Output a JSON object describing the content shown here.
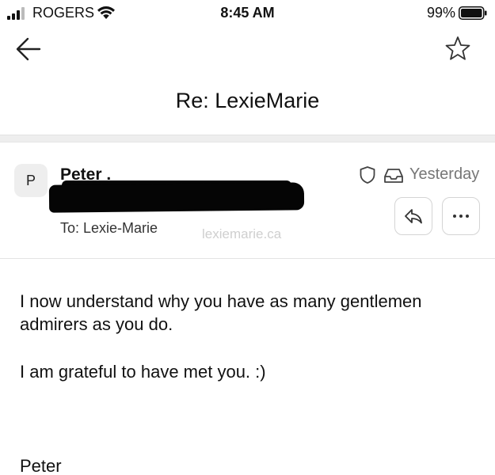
{
  "status_bar": {
    "carrier": "ROGERS",
    "time": "8:45 AM",
    "battery": "99%"
  },
  "icons": {
    "back": "arrow-left-icon",
    "star": "star-icon",
    "shield": "shield-icon",
    "inbox": "inbox-tray-icon",
    "reply": "reply-arrow-icon",
    "more": "ellipsis-icon"
  },
  "email": {
    "subject": "Re: LexieMarie",
    "avatar_initial": "P",
    "sender_name": "Peter .",
    "date": "Yesterday",
    "to_line": "To: Lexie-Marie",
    "watermark": "lexiemarie.ca",
    "body": {
      "paragraph_1": "I now understand why you have as many gentlemen admirers as you do.",
      "paragraph_2": "I am grateful to have met you.  :)",
      "signature": "Peter"
    }
  }
}
